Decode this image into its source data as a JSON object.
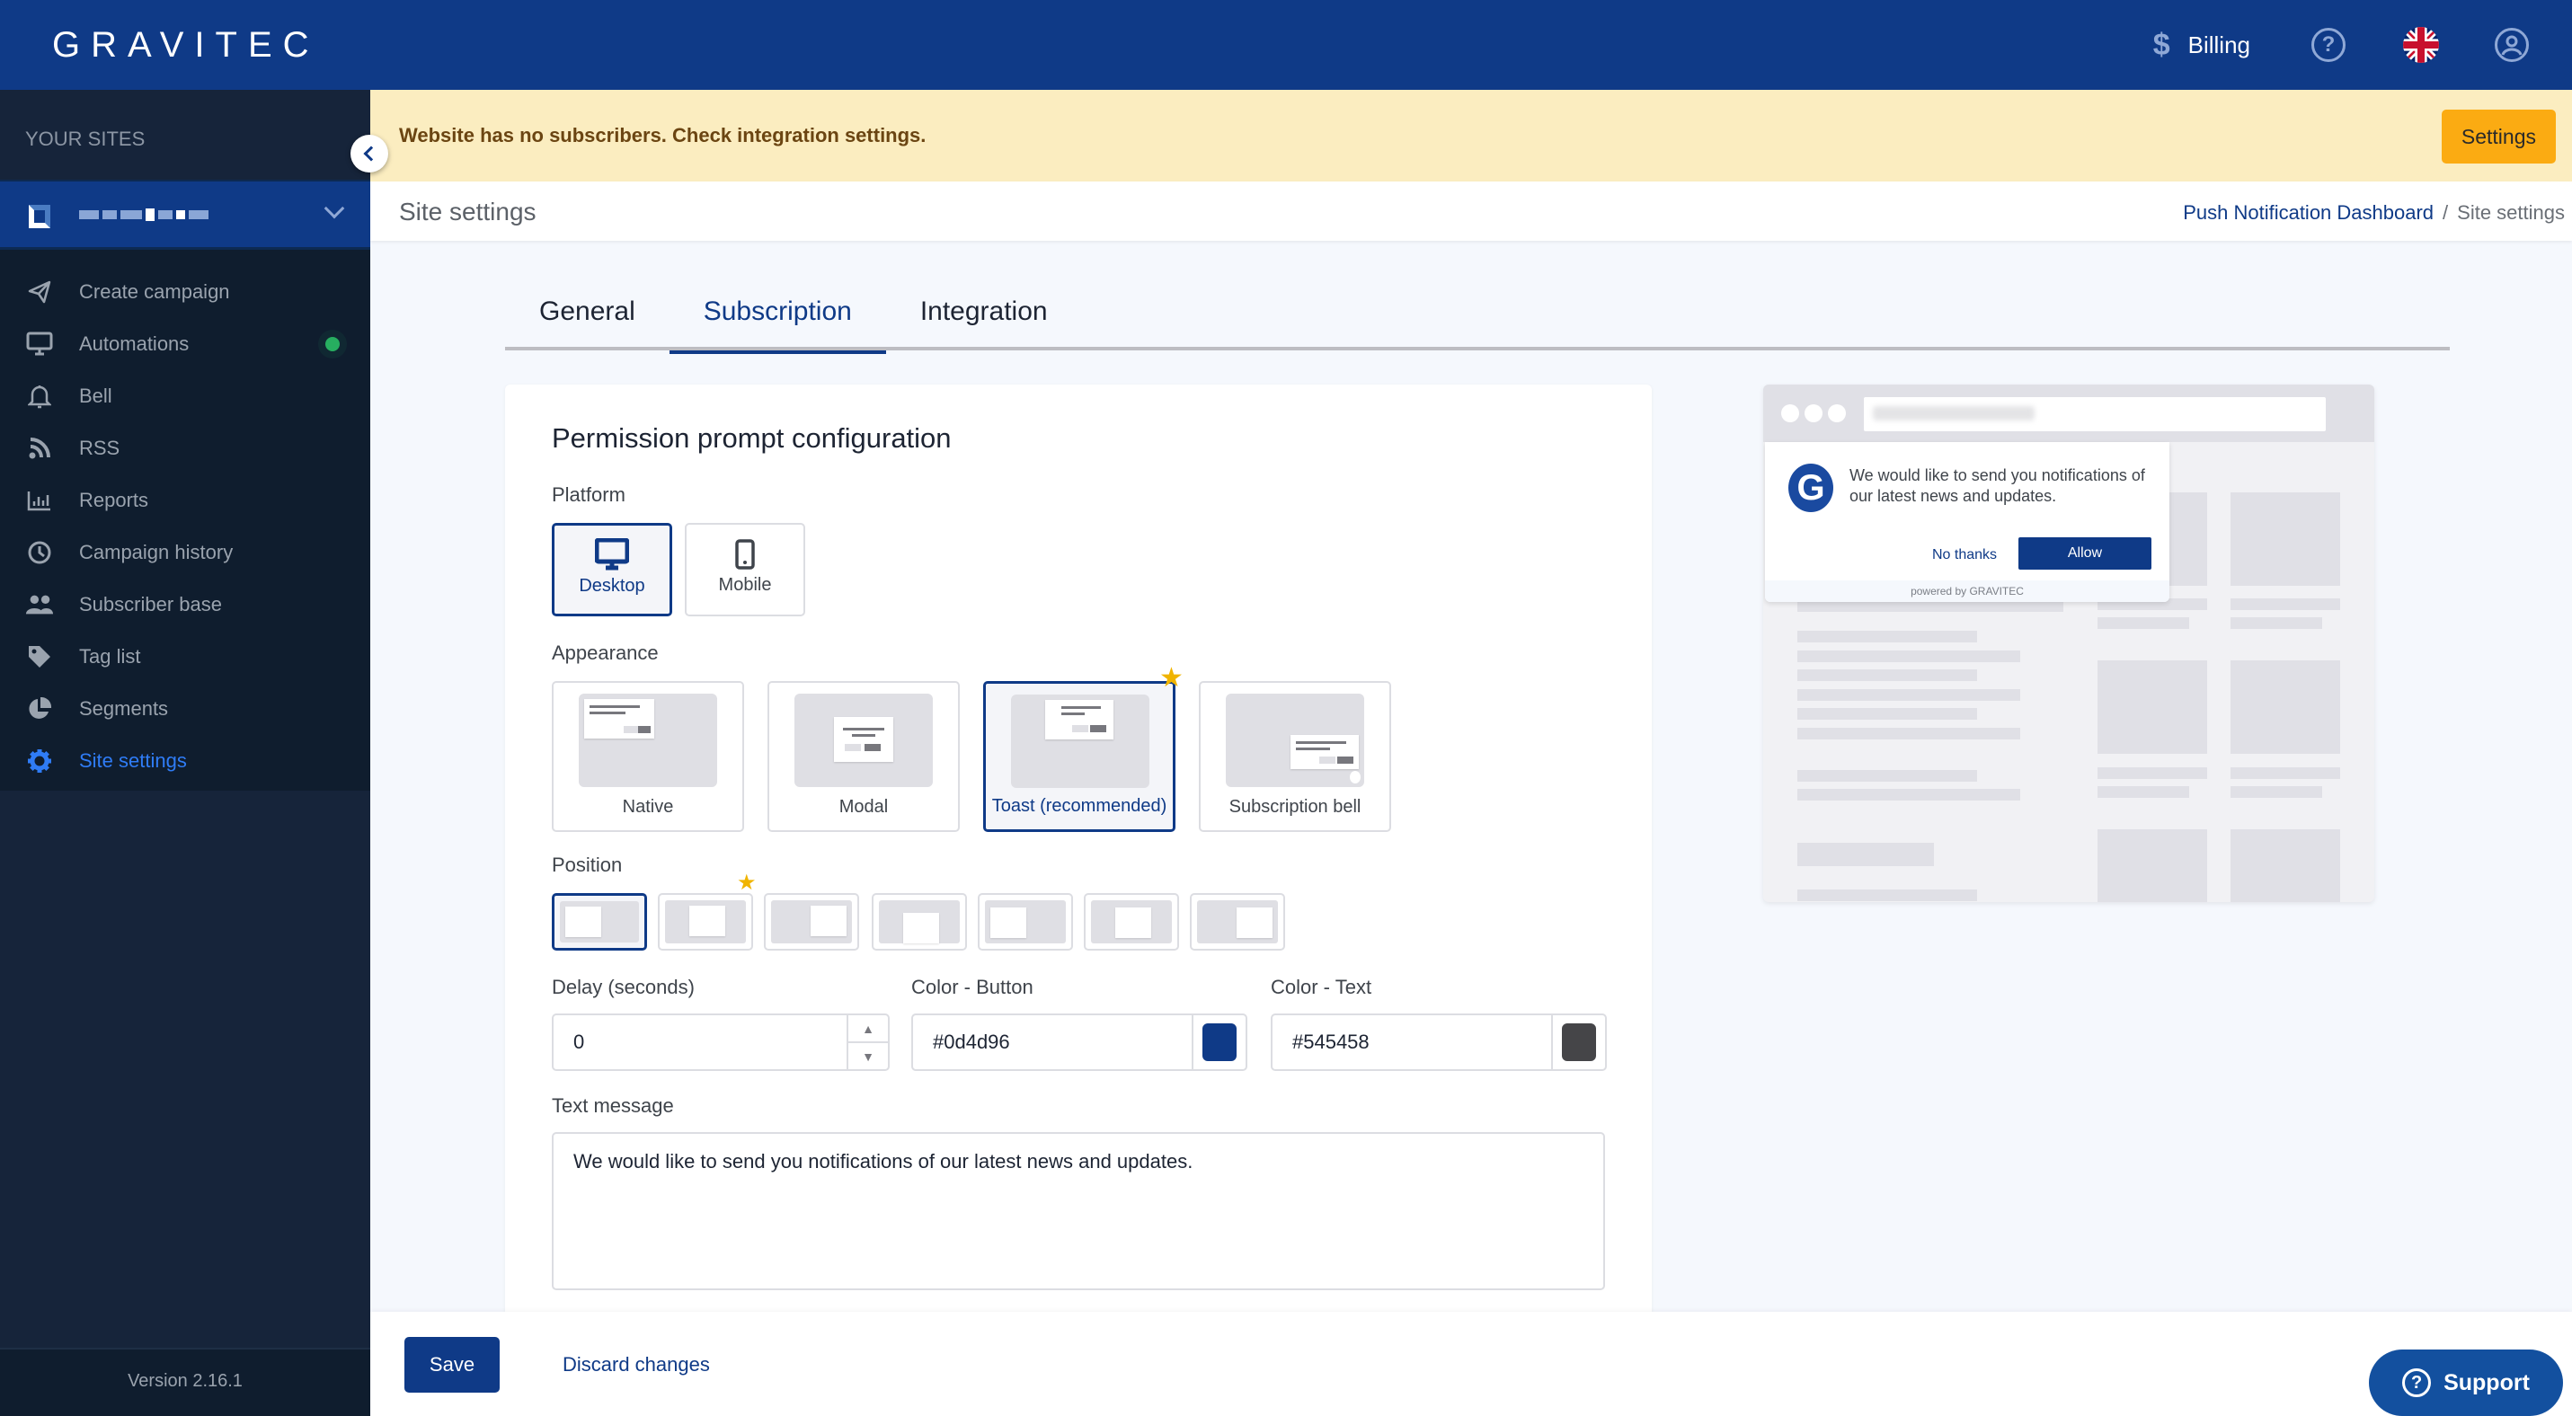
{
  "header": {
    "logo": "GRAVITEC",
    "billing_label": "Billing",
    "help_icon": "help-circle-icon",
    "language_icon": "uk-flag-icon",
    "user_icon": "user-circle-icon"
  },
  "sidebar": {
    "section_label": "YOUR SITES",
    "site_name": "[redacted site]",
    "items": [
      {
        "label": "Create campaign",
        "icon": "paper-plane-icon"
      },
      {
        "label": "Automations",
        "icon": "monitor-icon",
        "status": "active"
      },
      {
        "label": "Bell",
        "icon": "bell-icon"
      },
      {
        "label": "RSS",
        "icon": "rss-icon"
      },
      {
        "label": "Reports",
        "icon": "bar-chart-icon"
      },
      {
        "label": "Campaign history",
        "icon": "clock-icon"
      },
      {
        "label": "Subscriber base",
        "icon": "users-icon"
      },
      {
        "label": "Tag list",
        "icon": "tag-icon"
      },
      {
        "label": "Segments",
        "icon": "pie-chart-icon"
      },
      {
        "label": "Site settings",
        "icon": "gear-icon",
        "active": true
      }
    ],
    "version": "Version 2.16.1"
  },
  "banner": {
    "message": "Website has no subscribers. Check integration settings.",
    "button_label": "Settings"
  },
  "page": {
    "title": "Site settings",
    "breadcrumb": {
      "parent": "Push Notification Dashboard",
      "separator": "/",
      "current": "Site settings"
    }
  },
  "tabs": [
    {
      "label": "General"
    },
    {
      "label": "Subscription",
      "active": true
    },
    {
      "label": "Integration"
    }
  ],
  "form": {
    "title": "Permission prompt configuration",
    "platform_label": "Platform",
    "platforms": [
      {
        "label": "Desktop",
        "selected": true
      },
      {
        "label": "Mobile"
      }
    ],
    "appearance_label": "Appearance",
    "appearances": [
      {
        "label": "Native"
      },
      {
        "label": "Modal"
      },
      {
        "label": "Toast (recommended)",
        "selected": true,
        "recommended": true
      },
      {
        "label": "Subscription bell"
      }
    ],
    "position_label": "Position",
    "positions": [
      {
        "name": "top-left",
        "selected": true
      },
      {
        "name": "top-center",
        "recommended": true
      },
      {
        "name": "top-right"
      },
      {
        "name": "center"
      },
      {
        "name": "bottom-left"
      },
      {
        "name": "bottom-center"
      },
      {
        "name": "bottom-right"
      }
    ],
    "delay_label": "Delay (seconds)",
    "delay_value": "0",
    "color_button_label": "Color - Button",
    "color_button_value": "#0d4d96",
    "color_text_label": "Color - Text",
    "color_text_value": "#545458",
    "text_message_label": "Text message",
    "text_message_value": "We would like to send you notifications of our latest news and updates."
  },
  "preview": {
    "message": "We would like to send you notifications of our latest news and updates.",
    "deny_label": "No thanks",
    "allow_label": "Allow",
    "powered_by": "powered by GRAVITEC"
  },
  "footer": {
    "save_label": "Save",
    "discard_label": "Discard changes",
    "support_label": "Support"
  },
  "colors": {
    "brand": "#0f3a87",
    "sidebar_bg": "#0f1d2e",
    "active_nav": "#2f7cf6",
    "warning_bg": "#fbedc0",
    "warning_button": "#fbab12",
    "recommended_star": "#f0b400",
    "status_green": "#27ae60"
  }
}
